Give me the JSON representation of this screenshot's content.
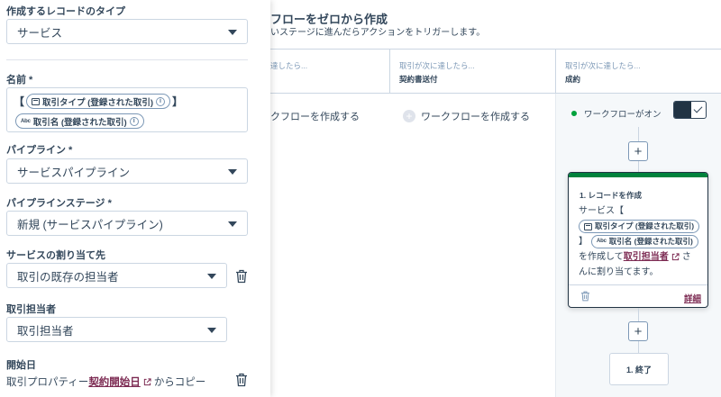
{
  "panel": {
    "record_type_label": "作成するレコードのタイプ",
    "record_type_value": "サービス",
    "name_label": "名前 *",
    "name_token_open": "【",
    "name_token_close": "】",
    "name_pill_1": "取引タイプ (登録された取引)",
    "name_pill_2": "取引名 (登録された取引)",
    "abc_icon_text": "Abc",
    "info_icon_text": "i",
    "pipeline_label": "パイプライン *",
    "pipeline_value": "サービスパイプライン",
    "stage_label": "パイプラインステージ *",
    "stage_value": "新規 (サービスパイプライン)",
    "assign_label": "サービスの割り当て先",
    "assign_value": "取引の既存の担当者",
    "owner_label": "取引担当者",
    "owner_value": "取引担当者",
    "start_label": "開始日",
    "start_prefix": "取引プロパティー",
    "start_link": "契約開始日",
    "start_suffix": "からコピー"
  },
  "main": {
    "title": "フローをゼロから作成",
    "subtitle": "いステージに進んだらアクションをトリガーします。",
    "stages": [
      {
        "top": "達したら...",
        "name": ""
      },
      {
        "top": "取引が次に達したら...",
        "name": "契約書送付"
      },
      {
        "top": "取引が次に達したら...",
        "name": "成約"
      }
    ],
    "create_wf_1": "クフローを作成する",
    "create_wf_2": "ワークフローを作成する",
    "plus_symbol": "+",
    "workflow_on": "ワークフローがオン",
    "card": {
      "title": "1. レコードを作成",
      "line1": "サービス【",
      "pill_1": "取引タイプ (登録された取引)",
      "close_bracket": "】",
      "pill_2": "取引名 (登録された取引)",
      "mid_text": "を作成して",
      "link": "取引担当者",
      "tail_1": "さ",
      "tail_2": "んに割り当てます。",
      "detail": "詳細"
    },
    "end_label": "1. 終了"
  },
  "colors": {
    "accent_link": "#7c2a52",
    "status_green": "#00a23c",
    "card_bar": "#00823c",
    "text": "#33475b"
  }
}
